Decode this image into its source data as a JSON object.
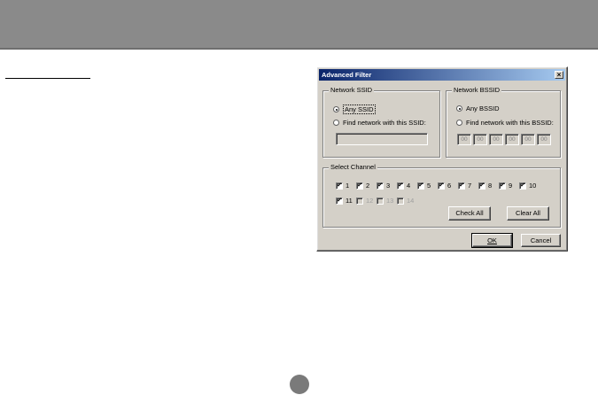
{
  "dialog": {
    "title": "Advanced Filter",
    "close_glyph": "×",
    "ssid_group": {
      "legend": "Network SSID",
      "any_label": "Any SSID",
      "find_label": "Find network with this SSID:",
      "selected": "any",
      "ssid_value": ""
    },
    "bssid_group": {
      "legend": "Network BSSID",
      "any_label": "Any BSSID",
      "find_label": "Find network with this BSSID:",
      "selected": "any",
      "octets": [
        "00",
        "00",
        "00",
        "00",
        "00",
        "00"
      ]
    },
    "channel_group": {
      "legend": "Select Channel",
      "channels": [
        {
          "label": "1",
          "checked": true,
          "enabled": true
        },
        {
          "label": "2",
          "checked": true,
          "enabled": true
        },
        {
          "label": "3",
          "checked": true,
          "enabled": true
        },
        {
          "label": "4",
          "checked": true,
          "enabled": true
        },
        {
          "label": "5",
          "checked": true,
          "enabled": true
        },
        {
          "label": "6",
          "checked": true,
          "enabled": true
        },
        {
          "label": "7",
          "checked": true,
          "enabled": true
        },
        {
          "label": "8",
          "checked": true,
          "enabled": true
        },
        {
          "label": "9",
          "checked": true,
          "enabled": true
        },
        {
          "label": "10",
          "checked": true,
          "enabled": true
        },
        {
          "label": "11",
          "checked": true,
          "enabled": true
        },
        {
          "label": "12",
          "checked": false,
          "enabled": false
        },
        {
          "label": "13",
          "checked": false,
          "enabled": false
        },
        {
          "label": "14",
          "checked": false,
          "enabled": false
        }
      ],
      "check_all_label": "Check All",
      "clear_all_label": "Clear All"
    },
    "ok_label": "OK",
    "cancel_label": "Cancel",
    "check_glyph": "✔"
  },
  "colors": {
    "header_bar": "#8a8a8a",
    "dialog_face": "#d4d0c8",
    "titlebar_start": "#0a246a",
    "titlebar_end": "#a6caf0"
  }
}
